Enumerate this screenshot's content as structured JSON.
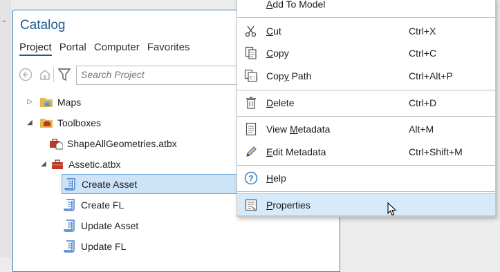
{
  "catalog": {
    "title": "Catalog",
    "tabs": [
      {
        "label": "Project",
        "active": true
      },
      {
        "label": "Portal",
        "active": false
      },
      {
        "label": "Computer",
        "active": false
      },
      {
        "label": "Favorites",
        "active": false
      }
    ],
    "search_placeholder": "Search Project",
    "tree": [
      {
        "label": "Maps",
        "expander": "collapsed",
        "icon": "maps-folder-icon"
      },
      {
        "label": "Toolboxes",
        "expander": "expanded",
        "icon": "toolboxes-folder-icon"
      },
      {
        "label": "ShapeAllGeometries.atbx",
        "expander": "none",
        "icon": "toolbox-home-icon"
      },
      {
        "label": "Assetic.atbx",
        "expander": "expanded",
        "icon": "toolbox-icon"
      },
      {
        "label": "Create Asset",
        "expander": "none",
        "icon": "script-tool-icon",
        "selected": true
      },
      {
        "label": "Create FL",
        "expander": "none",
        "icon": "script-tool-icon"
      },
      {
        "label": "Update Asset",
        "expander": "none",
        "icon": "script-tool-icon"
      },
      {
        "label": "Update FL",
        "expander": "none",
        "icon": "script-tool-icon"
      }
    ]
  },
  "context_menu": {
    "items": [
      {
        "pre": "",
        "u": "A",
        "post": "dd To Model",
        "shortcut": "",
        "icon": ""
      },
      {
        "pre": "",
        "u": "C",
        "post": "ut",
        "shortcut": "Ctrl+X",
        "icon": "scissors-icon"
      },
      {
        "pre": "",
        "u": "C",
        "post": "opy",
        "shortcut": "Ctrl+C",
        "icon": "copy-icon"
      },
      {
        "pre": "Cop",
        "u": "y",
        "post": " Path",
        "shortcut": "Ctrl+Alt+P",
        "icon": "copy-path-icon"
      },
      {
        "pre": "",
        "u": "D",
        "post": "elete",
        "shortcut": "Ctrl+D",
        "icon": "trash-icon"
      },
      {
        "pre": "View ",
        "u": "M",
        "post": "etadata",
        "shortcut": "Alt+M",
        "icon": "view-metadata-icon"
      },
      {
        "pre": "",
        "u": "E",
        "post": "dit Metadata",
        "shortcut": "Ctrl+Shift+M",
        "icon": "pencil-icon"
      },
      {
        "pre": "",
        "u": "H",
        "post": "elp",
        "shortcut": "",
        "icon": "help-icon"
      },
      {
        "pre": "",
        "u": "P",
        "post": "roperties",
        "shortcut": "",
        "icon": "properties-icon",
        "hover": true
      }
    ]
  },
  "colors": {
    "accent": "#1e5a96",
    "selection": "#cde3f7",
    "menu_hover": "#d7eafa",
    "folder": "#e8b64a",
    "toolbox_red": "#c0392b"
  }
}
